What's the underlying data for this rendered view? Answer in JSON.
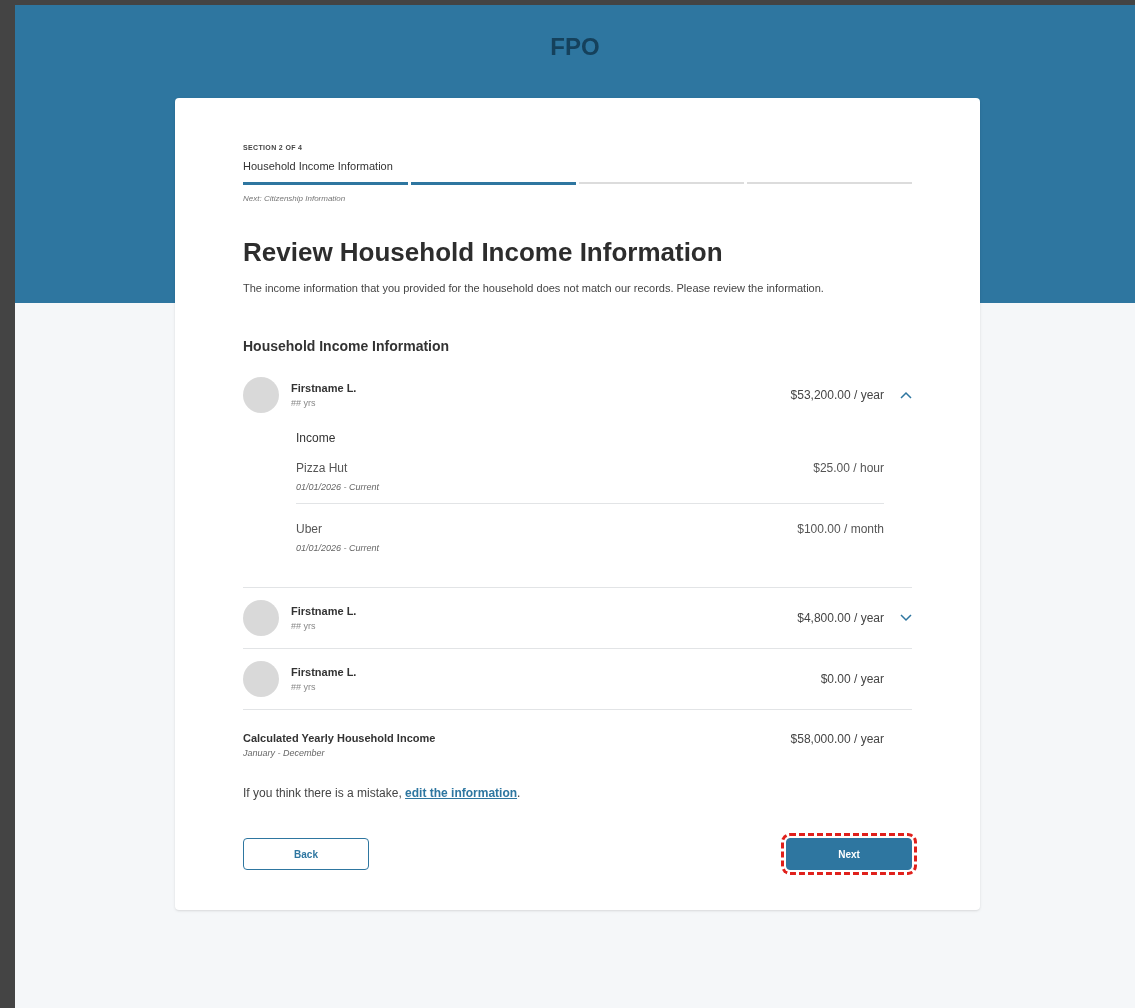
{
  "banner": {
    "label": "FPO"
  },
  "progress": {
    "section": "SECTION 2 OF 4",
    "title": "Household Income Information",
    "next": "Next: Citizenship Information",
    "segments": [
      {
        "filled": true
      },
      {
        "filled": true
      },
      {
        "filled": false
      },
      {
        "filled": false
      }
    ]
  },
  "heading": "Review Household Income Information",
  "intro": "The income information that you provided for the household does not match our records. Please review the information.",
  "section_title": "Household Income Information",
  "members": [
    {
      "name": "Firstname L.",
      "age": "## yrs",
      "amount": "$53,200.00 / year",
      "expandable": true,
      "expanded": true,
      "details": {
        "title": "Income",
        "items": [
          {
            "source": "Pizza Hut",
            "dates": "01/01/2026 - Current",
            "amount": "$25.00 / hour"
          },
          {
            "source": "Uber",
            "dates": "01/01/2026 - Current",
            "amount": "$100.00 / month"
          }
        ]
      }
    },
    {
      "name": "Firstname L.",
      "age": "## yrs",
      "amount": "$4,800.00 / year",
      "expandable": true,
      "expanded": false
    },
    {
      "name": "Firstname L.",
      "age": "## yrs",
      "amount": "$0.00 / year",
      "expandable": false
    }
  ],
  "total": {
    "label": "Calculated Yearly Household Income",
    "period": "January - December",
    "amount": "$58,000.00 / year"
  },
  "mistake": {
    "text": "If you think there is a mistake, ",
    "link": "edit the information",
    "end": "."
  },
  "buttons": [
    {
      "kind": "secondary",
      "label": "Back",
      "highlighted": false
    },
    {
      "kind": "primary",
      "label": "Next",
      "highlighted": true
    }
  ]
}
